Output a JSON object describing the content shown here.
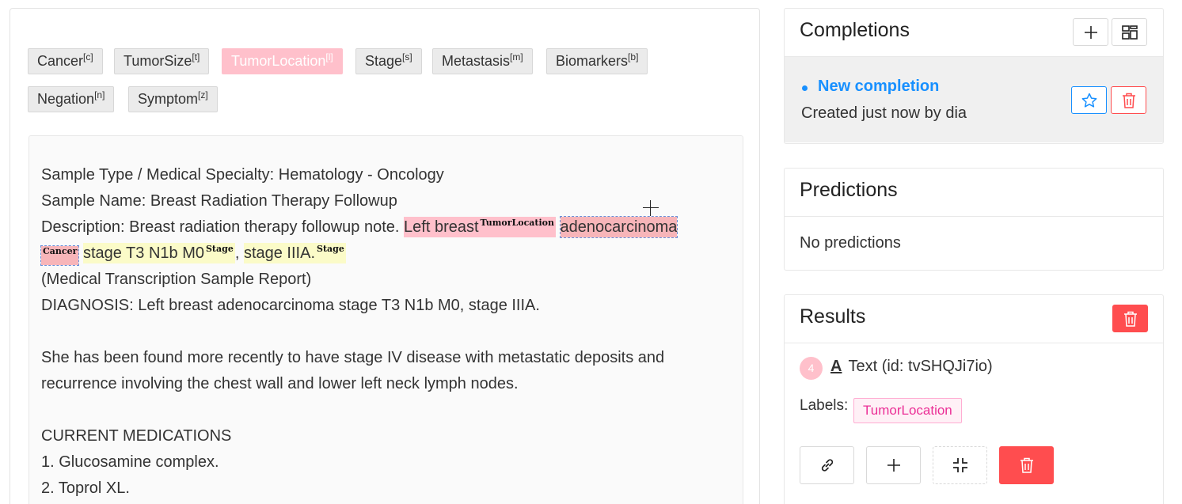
{
  "labels": [
    {
      "name": "Cancer",
      "key": "c",
      "active": false
    },
    {
      "name": "TumorSize",
      "key": "t",
      "active": false
    },
    {
      "name": "TumorLocation",
      "key": "l",
      "active": true
    },
    {
      "name": "Stage",
      "key": "s",
      "active": false
    },
    {
      "name": "Metastasis",
      "key": "m",
      "active": false
    },
    {
      "name": "Biomarkers",
      "key": "b",
      "active": false
    },
    {
      "name": "Negation",
      "key": "n",
      "active": false
    },
    {
      "name": "Symptom",
      "key": "z",
      "active": false
    }
  ],
  "document": {
    "line1": "Sample Type / Medical Specialty: Hematology - Oncology",
    "line2": "Sample Name: Breast Radiation Therapy Followup",
    "line3_pre": "Description: Breast radiation therapy followup note. ",
    "span_left_breast": "Left breast",
    "tag_tumor_location": "TumorLocation",
    "span_adenocarcinoma": "adenocarcinoma",
    "tag_cancer": "Cancer",
    "span_stage1": "stage T3 N1b M0",
    "tag_stage1": "Stage",
    "comma": ", ",
    "span_stage2": "stage IIIA.",
    "tag_stage2": "Stage",
    "line5": "(Medical Transcription Sample Report)",
    "line6": "DIAGNOSIS: Left breast adenocarcinoma stage T3 N1b M0, stage IIIA.",
    "line8": "She has been found more recently to have stage IV disease with metastatic deposits and",
    "line9": "recurrence involving the chest wall and lower left neck lymph nodes.",
    "line11": "CURRENT MEDICATIONS",
    "line12": "1. Glucosamine complex.",
    "line13": "2. Toprol XL."
  },
  "completions": {
    "title": "Completions",
    "item_name": "New completion",
    "item_sub": "Created just now by dia"
  },
  "predictions": {
    "title": "Predictions",
    "empty": "No predictions"
  },
  "results": {
    "title": "Results",
    "region_index": "4",
    "region_icon_glyph": "A",
    "region_text": "Text (id: tvSHQJi7io)",
    "labels_prefix": "Labels:",
    "label_chip": "TumorLocation"
  },
  "colors": {
    "tumor_location": "#ffc0cb",
    "cancer": "#f7b5b9",
    "stage": "#fbfbc8",
    "accent": "#1890ff",
    "danger": "#ff4d4f"
  }
}
